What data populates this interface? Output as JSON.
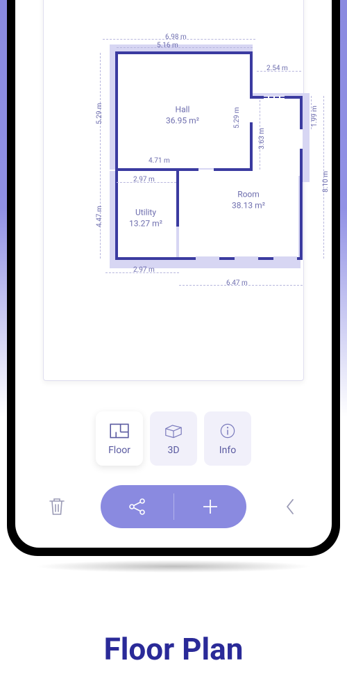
{
  "page_title": "Floor Plan",
  "rooms": {
    "hall": {
      "name": "Hall",
      "area": "36.95 m²"
    },
    "room": {
      "name": "Room",
      "area": "38.13 m²"
    },
    "utility": {
      "name": "Utility",
      "area": "13.27 m²"
    }
  },
  "dimensions": {
    "top_outer": "6.98 m",
    "top_inner": "5.16 m",
    "notch_w": "2.54 m",
    "hall_bottom": "4.71 m",
    "util_top": "2.97 m",
    "util_bottom": "2.97 m",
    "room_bottom": "6.47 m",
    "left_upper": "5.29 m",
    "left_lower": "4.47 m",
    "notch_h": "1.99 m",
    "right_full": "8.10 m",
    "inner_v1": "5.29 m",
    "inner_v2": "3.63 m"
  },
  "tabs": {
    "floor": "Floor",
    "threeD": "3D",
    "info": "Info"
  },
  "colors": {
    "accent": "#3b3ba0",
    "accent_light": "#8a8ae0",
    "shadow": "#d7d6f3"
  }
}
